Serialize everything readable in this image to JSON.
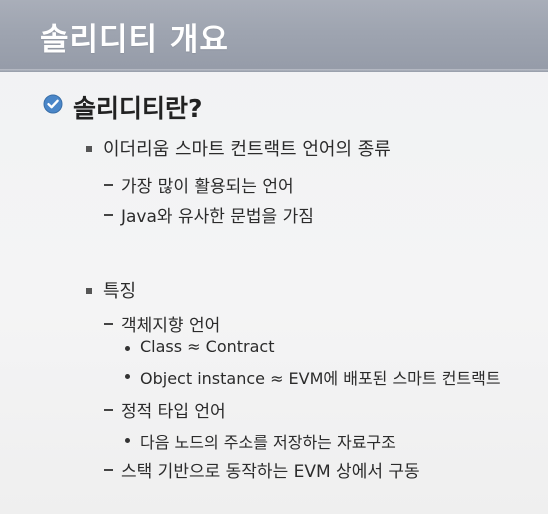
{
  "slide": {
    "title": "솔리디티 개요",
    "heading": "솔리디티란?",
    "items": [
      {
        "text": "이더리움 스마트 컨트랙트 언어의 종류",
        "subitems": [
          {
            "text": "가장 많이 활용되는 언어"
          },
          {
            "text": "Java와 유사한 문법을 가짐"
          }
        ]
      },
      {
        "text": "특징",
        "subitems": [
          {
            "text": "객체지향 언어",
            "points": [
              "Class ≈ Contract",
              "Object instance ≈ EVM에 배포된 스마트 컨트랙트"
            ]
          },
          {
            "text": "정적 타입 언어",
            "points": [
              "다음 노드의 주소를 저장하는 자료구조"
            ]
          },
          {
            "text": "스택 기반으로 동작하는 EVM 상에서 구동"
          }
        ]
      }
    ]
  },
  "colors": {
    "title_bar": "#9ea4b0",
    "check_bullet": "#4a86c8"
  },
  "icons": {
    "heading_bullet": "check-circle-icon"
  }
}
